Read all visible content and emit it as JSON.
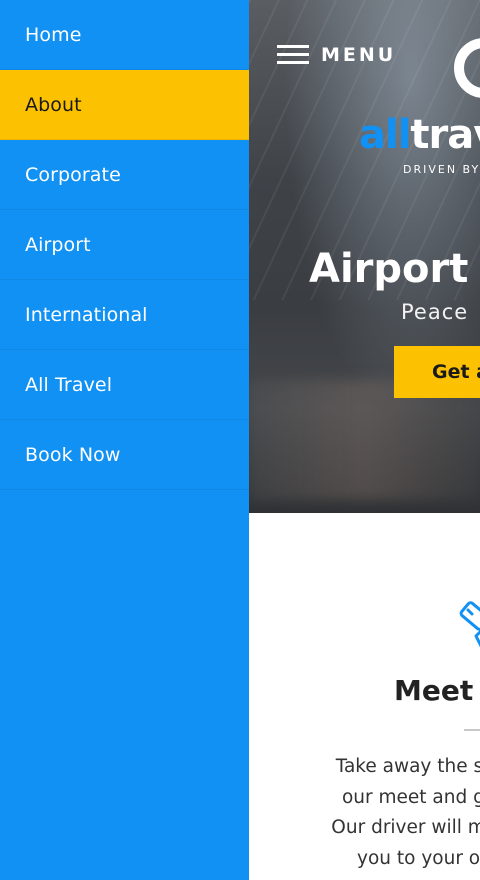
{
  "sidebar": {
    "items": [
      {
        "label": "Home"
      },
      {
        "label": "About"
      },
      {
        "label": "Corporate"
      },
      {
        "label": "Airport"
      },
      {
        "label": "International"
      },
      {
        "label": "All Travel"
      },
      {
        "label": "Book Now"
      }
    ],
    "active_item": "About"
  },
  "header": {
    "menu_label": "MENU",
    "logo_all": "all",
    "logo_travel": "travel",
    "tagline": "DRIVEN BY"
  },
  "hero": {
    "title": "Airport T",
    "subtitle": "Peace",
    "cta_label": "Get a"
  },
  "feature": {
    "icon": "hand-icon",
    "title": "Meet a",
    "lines": [
      "Take away the stress",
      "our meet and greet",
      "Our driver will meet y",
      "you to your onw"
    ]
  },
  "colors": {
    "brand_blue": "#1191f3",
    "accent_yellow": "#fcc101",
    "text_dark": "#222222"
  }
}
